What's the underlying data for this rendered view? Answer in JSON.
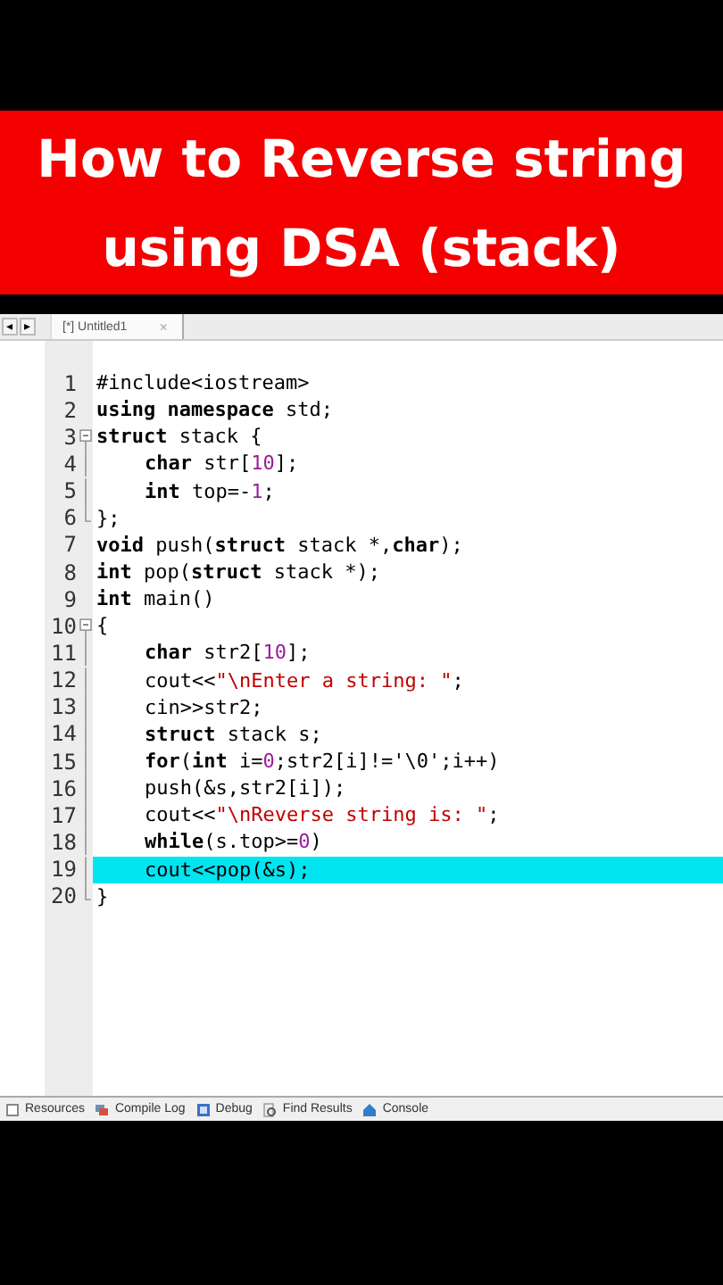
{
  "banner": {
    "lines": [
      "How to Reverse string",
      "using DSA (stack)"
    ]
  },
  "tab_bar": {
    "nav": [
      "◂",
      "▸"
    ],
    "tabs": [
      {
        "label": "[*] Untitled1",
        "close": "×",
        "selected": true
      }
    ]
  },
  "editor": {
    "lines": [
      {
        "number": "1",
        "selected": false,
        "kind": "plain",
        "indented": false,
        "segments": [
          {
            "kind": "plain",
            "text": "#include<iostream>"
          }
        ]
      },
      {
        "number": "2",
        "selected": false,
        "kind": "plain",
        "indented": false,
        "segments": [
          {
            "kind": "keyword",
            "text": "using namespace"
          },
          {
            "kind": "plain",
            "text": " std;"
          }
        ]
      },
      {
        "number": "3",
        "selected": false,
        "kind": "opener",
        "indented": false,
        "segments": [
          {
            "kind": "keyword",
            "text": "struct"
          },
          {
            "kind": "plain",
            "text": " stack {"
          }
        ]
      },
      {
        "number": "4",
        "selected": false,
        "kind": "inner",
        "indented": true,
        "segments": [
          {
            "kind": "keyword",
            "text": "char"
          },
          {
            "kind": "plain",
            "text": " str["
          },
          {
            "kind": "number",
            "text": "10"
          },
          {
            "kind": "plain",
            "text": "];"
          }
        ]
      },
      {
        "number": "5",
        "selected": false,
        "kind": "inner",
        "indented": true,
        "segments": [
          {
            "kind": "keyword",
            "text": "int"
          },
          {
            "kind": "plain",
            "text": " top=-"
          },
          {
            "kind": "number",
            "text": "1"
          },
          {
            "kind": "plain",
            "text": ";"
          }
        ]
      },
      {
        "number": "6",
        "selected": false,
        "kind": "closer",
        "indented": false,
        "segments": [
          {
            "kind": "plain",
            "text": "};"
          }
        ]
      },
      {
        "number": "7",
        "selected": false,
        "kind": "plain",
        "indented": false,
        "segments": [
          {
            "kind": "keyword",
            "text": "void"
          },
          {
            "kind": "plain",
            "text": " push("
          },
          {
            "kind": "keyword",
            "text": "struct"
          },
          {
            "kind": "plain",
            "text": " stack *,"
          },
          {
            "kind": "keyword",
            "text": "char"
          },
          {
            "kind": "plain",
            "text": ");"
          }
        ]
      },
      {
        "number": "8",
        "selected": false,
        "kind": "plain",
        "indented": false,
        "segments": [
          {
            "kind": "keyword",
            "text": "int"
          },
          {
            "kind": "plain",
            "text": " pop("
          },
          {
            "kind": "keyword",
            "text": "struct"
          },
          {
            "kind": "plain",
            "text": " stack *);"
          }
        ]
      },
      {
        "number": "9",
        "selected": false,
        "kind": "plain",
        "indented": false,
        "segments": [
          {
            "kind": "keyword",
            "text": "int"
          },
          {
            "kind": "plain",
            "text": " main()"
          }
        ]
      },
      {
        "number": "10",
        "selected": false,
        "kind": "opener",
        "indented": false,
        "segments": [
          {
            "kind": "plain",
            "text": "{"
          }
        ]
      },
      {
        "number": "11",
        "selected": false,
        "kind": "inner",
        "indented": true,
        "segments": [
          {
            "kind": "keyword",
            "text": "char"
          },
          {
            "kind": "plain",
            "text": " str2["
          },
          {
            "kind": "number",
            "text": "10"
          },
          {
            "kind": "plain",
            "text": "];"
          }
        ]
      },
      {
        "number": "12",
        "selected": false,
        "kind": "inner",
        "indented": true,
        "segments": [
          {
            "kind": "plain",
            "text": "cout<<"
          },
          {
            "kind": "string",
            "text": "\"\\nEnter a string: \""
          },
          {
            "kind": "plain",
            "text": ";"
          }
        ]
      },
      {
        "number": "13",
        "selected": false,
        "kind": "inner",
        "indented": true,
        "segments": [
          {
            "kind": "plain",
            "text": "cin>>str2;"
          }
        ]
      },
      {
        "number": "14",
        "selected": false,
        "kind": "inner",
        "indented": true,
        "segments": [
          {
            "kind": "keyword",
            "text": "struct"
          },
          {
            "kind": "plain",
            "text": " stack s;"
          }
        ]
      },
      {
        "number": "15",
        "selected": false,
        "kind": "inner",
        "indented": true,
        "segments": [
          {
            "kind": "keyword",
            "text": "for"
          },
          {
            "kind": "plain",
            "text": "("
          },
          {
            "kind": "keyword",
            "text": "int"
          },
          {
            "kind": "plain",
            "text": " i="
          },
          {
            "kind": "number",
            "text": "0"
          },
          {
            "kind": "plain",
            "text": ";str2[i]!='\\0';i++)"
          }
        ]
      },
      {
        "number": "16",
        "selected": false,
        "kind": "inner",
        "indented": true,
        "segments": [
          {
            "kind": "plain",
            "text": "push(&s,str2[i]);"
          }
        ]
      },
      {
        "number": "17",
        "selected": false,
        "kind": "inner",
        "indented": true,
        "segments": [
          {
            "kind": "plain",
            "text": "cout<<"
          },
          {
            "kind": "string",
            "text": "\"\\nReverse string is: \""
          },
          {
            "kind": "plain",
            "text": ";"
          }
        ]
      },
      {
        "number": "18",
        "selected": false,
        "kind": "inner",
        "indented": true,
        "segments": [
          {
            "kind": "keyword",
            "text": "while"
          },
          {
            "kind": "plain",
            "text": "(s.top>="
          },
          {
            "kind": "number",
            "text": "0"
          },
          {
            "kind": "plain",
            "text": ")"
          }
        ]
      },
      {
        "number": "19",
        "selected": true,
        "kind": "inner",
        "indented": true,
        "segments": [
          {
            "kind": "plain",
            "text": "cout<<pop(&s);"
          }
        ]
      },
      {
        "number": "20",
        "selected": false,
        "kind": "closer",
        "indented": false,
        "segments": [
          {
            "kind": "plain",
            "text": "}"
          }
        ]
      }
    ]
  },
  "bottom_tabs": [
    {
      "label": "Resources",
      "kind": "resources"
    },
    {
      "label": "Compile Log",
      "kind": "compile"
    },
    {
      "label": "Debug",
      "kind": "debug"
    },
    {
      "label": "Find Results",
      "kind": "find"
    },
    {
      "label": "Console",
      "kind": "console"
    }
  ]
}
